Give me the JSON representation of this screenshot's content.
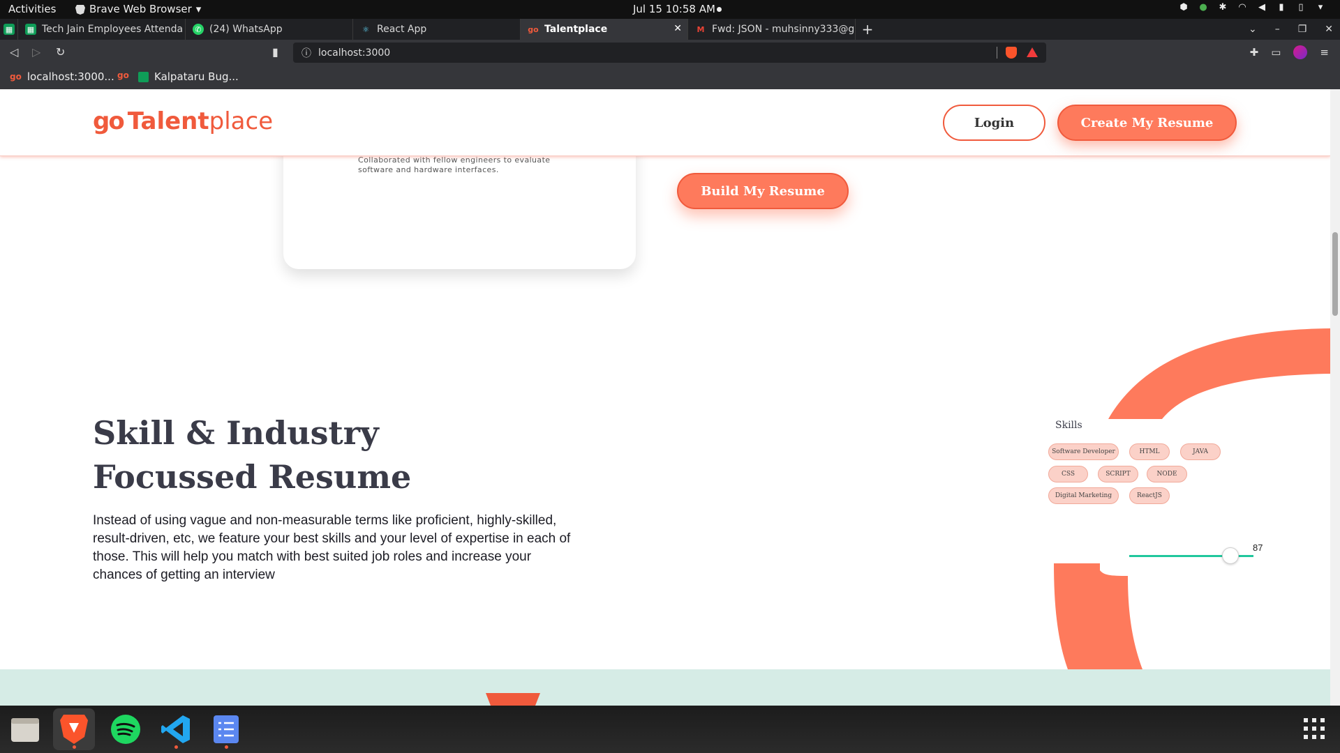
{
  "system_bar": {
    "activities": "Activities",
    "app_name": "Brave Web Browser",
    "clock": "Jul 15  10:58 AM"
  },
  "tabs": [
    {
      "label": "Tech Jain Employees Attenda",
      "icon": "google-sheets-icon",
      "color": "#0f9d58"
    },
    {
      "label": "(24) WhatsApp",
      "icon": "whatsapp-icon",
      "color": "#25d366"
    },
    {
      "label": "React App",
      "icon": "react-icon",
      "color": "#61dafb"
    },
    {
      "label": "Talentplace",
      "icon": "talentplace-icon",
      "color": "#f05a3c"
    },
    {
      "label": "Fwd: JSON - muhsinny333@g",
      "icon": "gmail-icon",
      "color": "#ea4335"
    }
  ],
  "address_bar": {
    "url": "localhost:3000"
  },
  "bookmarks": [
    {
      "label": "localhost:3000...",
      "icon": "talentplace-icon"
    },
    {
      "label": "Kalpataru Bug...",
      "icon": "google-sheets-icon"
    }
  ],
  "site": {
    "brand": {
      "prefix": "go",
      "strong": "Talent",
      "rest": "place"
    },
    "login_label": "Login",
    "create_label": "Create My Resume",
    "build_label": "Build My Resume",
    "card_description": "Collaborated with fellow engineers to evaluate software and hardware interfaces.",
    "section_title_line1": "Skill & Industry",
    "section_title_line2": "Focussed Resume",
    "section_description": "Instead of using vague and non-measurable terms like proficient, highly-skilled, result-driven, etc, we feature your best skills and your level of expertise in each of those. This will help you match with best suited job roles and increase your chances of getting an interview",
    "skills_title": "Skills",
    "skills": [
      "Software Developer",
      "HTML",
      "JAVA",
      "CSS",
      "SCRIPT",
      "NODE",
      "Digital Marketing",
      "ReactJS"
    ],
    "skill_level": 87,
    "skill_level_label": "87",
    "accent_color": "#fe7a5c",
    "brand_color": "#f05a3c",
    "slider_color": "#21c79d",
    "mint_color": "#d6ece6"
  },
  "dock": [
    {
      "name": "files-icon"
    },
    {
      "name": "brave-icon"
    },
    {
      "name": "spotify-icon"
    },
    {
      "name": "vscode-icon"
    },
    {
      "name": "tasks-icon"
    }
  ]
}
